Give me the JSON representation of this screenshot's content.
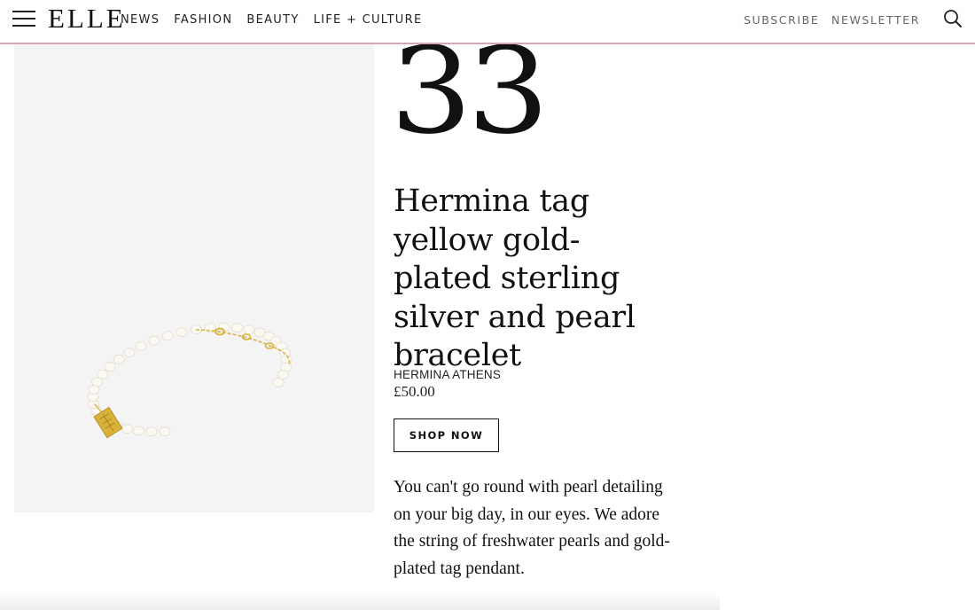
{
  "header": {
    "logo": "ELLE",
    "nav": [
      "NEWS",
      "FASHION",
      "BEAUTY",
      "LIFE + CULTURE"
    ],
    "subscribe": "SUBSCRIBE",
    "newsletter": "NEWSLETTER"
  },
  "product": {
    "rank": "33",
    "title": "Hermina tag yellow gold-plated sterling silver and pearl bracelet",
    "brand": "HERMINA ATHENS",
    "price": "£50.00",
    "cta": "SHOP NOW",
    "description": "You can't go round with pearl detailing on your big day, in our eyes. We adore the string of freshwater pearls and gold-plated tag pendant."
  },
  "colors": {
    "header_border": "#d4a8b6",
    "image_bg": "#f4f4f4",
    "gold": "#d9b23a",
    "pearl": "#fbf8f2"
  }
}
